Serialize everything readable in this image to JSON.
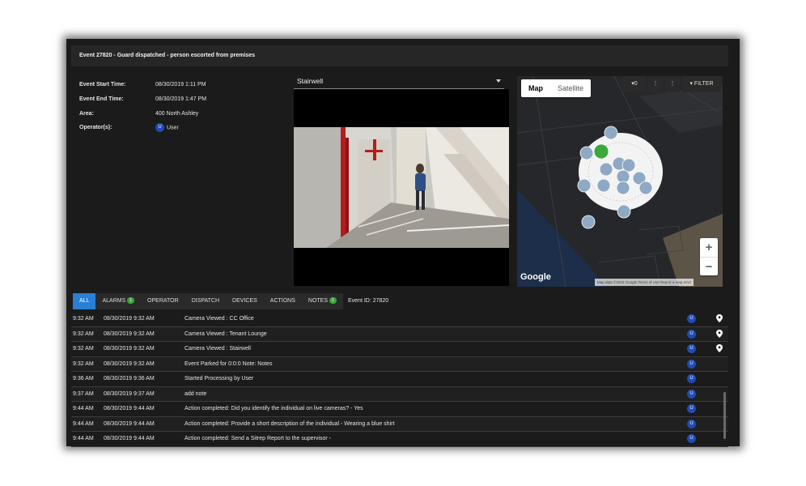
{
  "title": "Event 27820 - Guard dispatched - person escorted from premises",
  "details": [
    {
      "key": "Event Start Time:",
      "value": "08/30/2019 1:11 PM"
    },
    {
      "key": "Event End Time:",
      "value": "08/30/2019 1:47 PM"
    },
    {
      "key": "Area:",
      "value": "400 North Ashley"
    },
    {
      "key": "Operator(s):",
      "value": "User",
      "avatar": "U"
    }
  ],
  "camera": {
    "selected": "Stairwell"
  },
  "map": {
    "type_buttons": [
      "Map",
      "Satellite"
    ],
    "count_label": "0",
    "filter_label": "FILTER",
    "zoom_in": "+",
    "zoom_out": "−",
    "logo": "Google",
    "attribution": "Map data ©2019 Google   Terms of Use   Report a map error"
  },
  "tabs": [
    {
      "label": "ALL",
      "active": true
    },
    {
      "label": "ALARMS",
      "badge": "1"
    },
    {
      "label": "OPERATOR"
    },
    {
      "label": "DISPATCH"
    },
    {
      "label": "DEVICES"
    },
    {
      "label": "ACTIONS"
    },
    {
      "label": "NOTES",
      "badge": "1"
    }
  ],
  "event_id_label": "Event ID: 27820",
  "rows": [
    {
      "time": "9:32 AM",
      "datetime": "08/30/2019 9:32 AM",
      "text": "Camera Viewed : CC Office",
      "user": "U",
      "pin": true
    },
    {
      "time": "9:32 AM",
      "datetime": "08/30/2019 9:32 AM",
      "text": "Camera Viewed : Tenant Lounge",
      "user": "U",
      "pin": true
    },
    {
      "time": "9:32 AM",
      "datetime": "08/30/2019 9:32 AM",
      "text": "Camera Viewed : Stairwell",
      "user": "U",
      "pin": true
    },
    {
      "time": "9:32 AM",
      "datetime": "08/30/2019 9:32 AM",
      "text": "Event Parked for 0:0:0 Note: Notes",
      "user": "U",
      "pin": false
    },
    {
      "time": "9:36 AM",
      "datetime": "08/30/2019 9:36 AM",
      "text": "Started Processing by User",
      "user": "U",
      "pin": false
    },
    {
      "time": "9:37 AM",
      "datetime": "08/30/2019 9:37 AM",
      "text": "add note",
      "user": "U",
      "pin": false
    },
    {
      "time": "9:44 AM",
      "datetime": "08/30/2019 9:44 AM",
      "text": "Action completed: Did you identify the individual on live cameras? - Yes",
      "user": "U",
      "pin": false
    },
    {
      "time": "9:44 AM",
      "datetime": "08/30/2019 9:44 AM",
      "text": "Action completed: Provide a short description of the individual - Wearing a blue shirt",
      "user": "U",
      "pin": false
    },
    {
      "time": "9:44 AM",
      "datetime": "08/30/2019 9:44 AM",
      "text": "Action completed: Send a Sitrep Report to the supervisor -",
      "user": "U",
      "pin": false
    }
  ],
  "colors": {
    "accent": "#2a7fd4",
    "badge": "#3aa83a",
    "avatar": "#1f4bb6"
  }
}
